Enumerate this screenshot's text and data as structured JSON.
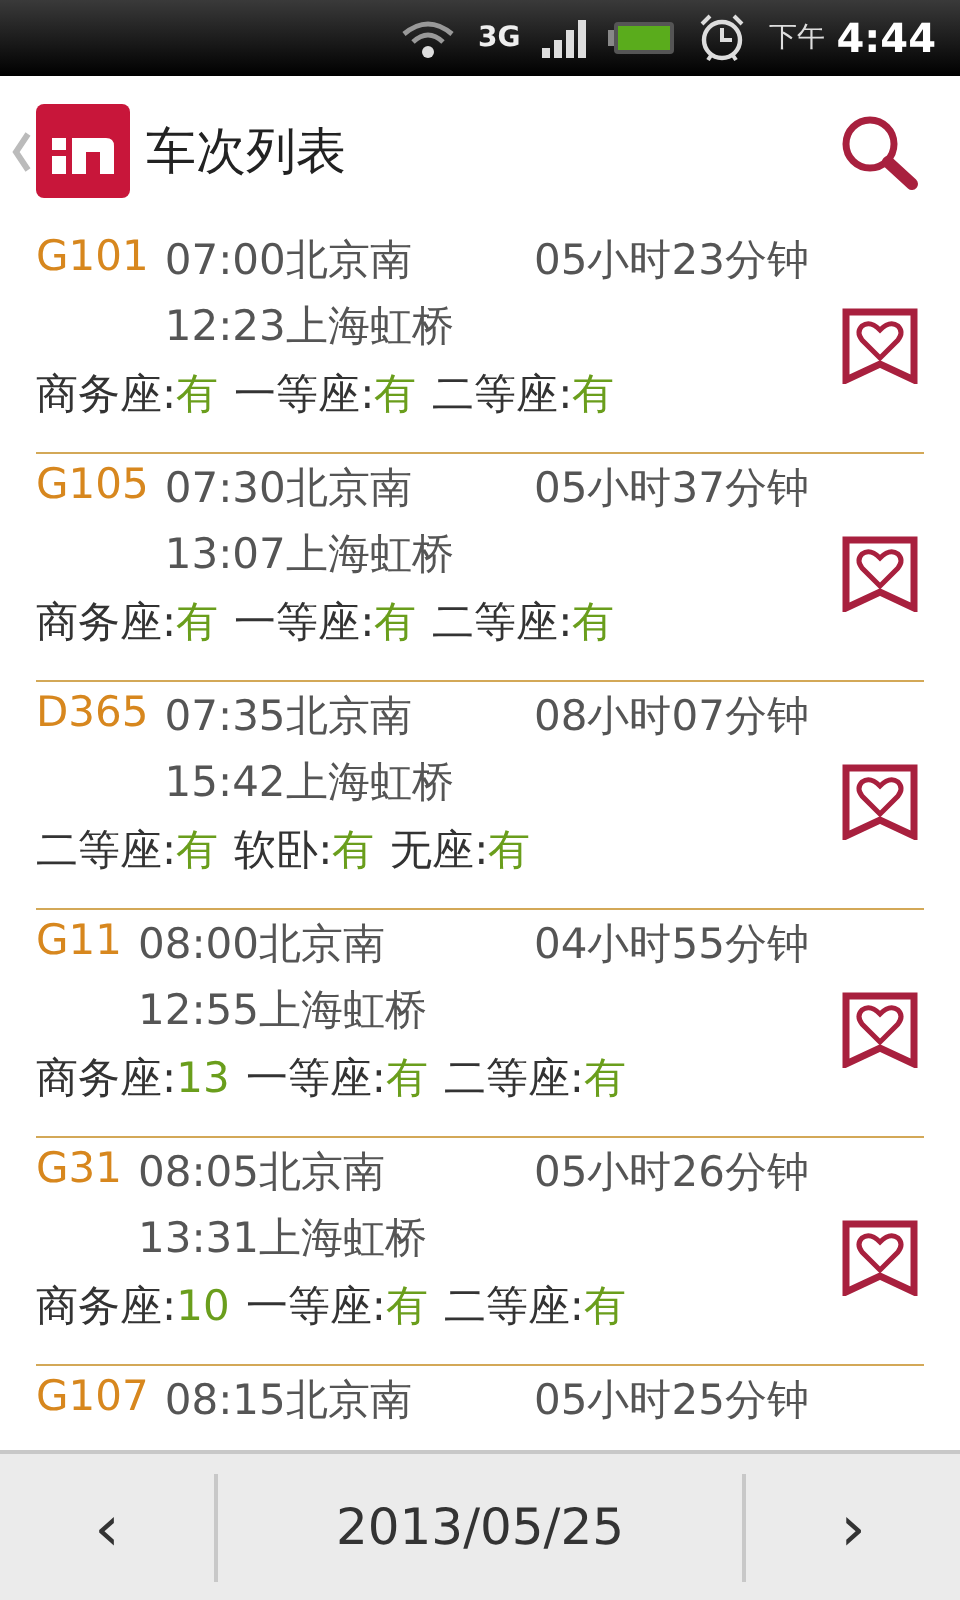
{
  "status_bar": {
    "network": "3G",
    "period": "下午",
    "time": "4:44"
  },
  "header": {
    "title": "车次列表"
  },
  "trains": [
    {
      "code": "G101",
      "depart": "07:00北京南",
      "duration": "05小时23分钟",
      "arrive": "12:23上海虹桥",
      "seats": [
        {
          "label": "商务座:",
          "value": "有"
        },
        {
          "label": "一等座:",
          "value": "有"
        },
        {
          "label": "二等座:",
          "value": "有"
        }
      ]
    },
    {
      "code": "G105",
      "depart": "07:30北京南",
      "duration": "05小时37分钟",
      "arrive": "13:07上海虹桥",
      "seats": [
        {
          "label": "商务座:",
          "value": "有"
        },
        {
          "label": "一等座:",
          "value": "有"
        },
        {
          "label": "二等座:",
          "value": "有"
        }
      ]
    },
    {
      "code": "D365",
      "depart": "07:35北京南",
      "duration": "08小时07分钟",
      "arrive": "15:42上海虹桥",
      "seats": [
        {
          "label": "二等座:",
          "value": "有"
        },
        {
          "label": "软卧:",
          "value": "有"
        },
        {
          "label": "无座:",
          "value": "有"
        }
      ]
    },
    {
      "code": "G11",
      "depart": "08:00北京南",
      "duration": "04小时55分钟",
      "arrive": "12:55上海虹桥",
      "seats": [
        {
          "label": "商务座:",
          "value": "13"
        },
        {
          "label": "一等座:",
          "value": "有"
        },
        {
          "label": "二等座:",
          "value": "有"
        }
      ]
    },
    {
      "code": "G31",
      "depart": "08:05北京南",
      "duration": "05小时26分钟",
      "arrive": "13:31上海虹桥",
      "seats": [
        {
          "label": "商务座:",
          "value": "10"
        },
        {
          "label": "一等座:",
          "value": "有"
        },
        {
          "label": "二等座:",
          "value": "有"
        }
      ]
    },
    {
      "code": "G107",
      "depart": "08:15北京南",
      "duration": "05小时25分钟"
    }
  ],
  "date_bar": {
    "prev": "‹",
    "date": "2013/05/25",
    "next": "›"
  }
}
